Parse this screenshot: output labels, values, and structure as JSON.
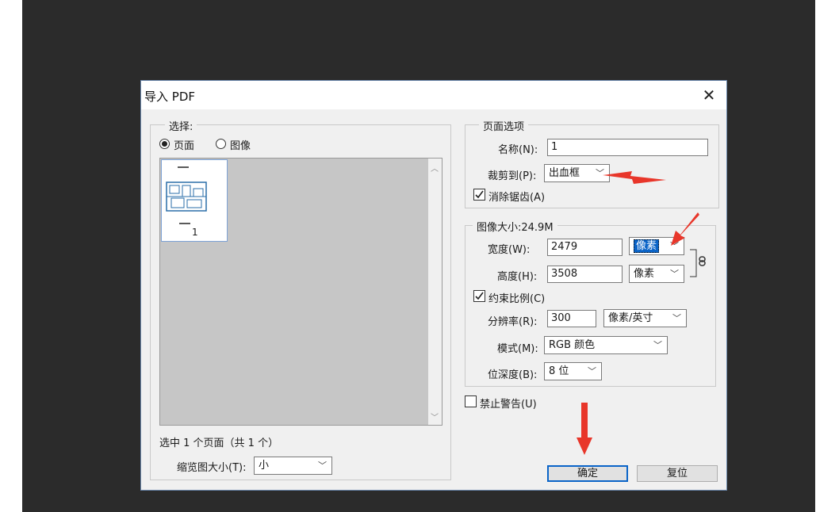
{
  "dialog": {
    "title": "导入 PDF",
    "close_glyph": "✕"
  },
  "select_group": {
    "legend": "选择:",
    "radio_page": "页面",
    "radio_image": "图像",
    "selected": "页面",
    "thumbnail_page_number": "1",
    "selection_summary": "选中 1 个页面（共 1 个）",
    "thumb_size_label": "缩览图大小(T):",
    "thumb_size_value": "小"
  },
  "page_options": {
    "legend": "页面选项",
    "name_label": "名称(N):",
    "name_value": "1",
    "crop_label": "裁剪到(P):",
    "crop_value": "出血框",
    "antialias_label": "消除锯齿(A)",
    "antialias_checked": true
  },
  "image_size": {
    "legend": "图像大小:24.9M",
    "width_label": "宽度(W):",
    "width_value": "2479",
    "width_unit": "像素",
    "height_label": "高度(H):",
    "height_value": "3508",
    "height_unit": "像素",
    "constrain_label": "约束比例(C)",
    "constrain_checked": true,
    "resolution_label": "分辨率(R):",
    "resolution_value": "300",
    "resolution_unit": "像素/英寸",
    "mode_label": "模式(M):",
    "mode_value": "RGB 颜色",
    "depth_label": "位深度(B):",
    "depth_value": "8 位"
  },
  "suppress_warnings_label": "禁止警告(U)",
  "buttons": {
    "ok": "确定",
    "reset": "复位"
  },
  "colors": {
    "annotation_arrow": "#e8362a",
    "accent": "#0a64c8"
  }
}
